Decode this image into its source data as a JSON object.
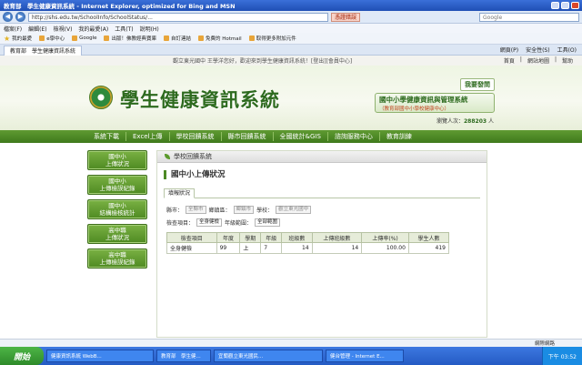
{
  "window": {
    "title": "教育部　學生健康資訊系統 - Internet Explorer, optimized for Bing and MSN"
  },
  "address": {
    "url": "http://shs.edu.tw/SchoolInfo/SchoolStatus/...",
    "cert": "憑證錯誤",
    "search_placeholder": "Google"
  },
  "menu": [
    "檔案(F)",
    "編輯(E)",
    "檢視(V)",
    "我的最愛(A)",
    "工具(T)",
    "說明(H)"
  ],
  "favorites": {
    "label": "我的最愛",
    "items": [
      "e學中心",
      "Google",
      "出版！佛教經典寶庫",
      "自訂連結",
      "免費的 Hotmail",
      "取得更多附加元件"
    ]
  },
  "tab": {
    "title": "教育部　學生健康資訊系統",
    "tools": [
      "網頁(P)",
      "安全性(S)",
      "工具(O)"
    ]
  },
  "page": {
    "welcome": "觀立東光國中 王學洋您好，歡迎來到學生健康資訊系統！[登出][會員中心]",
    "toplinks": [
      "首頁",
      "網站地圖",
      "幫助"
    ],
    "site_title": "學生健康資訊系統",
    "qa_button": "我要發問",
    "platform": {
      "title": "國中小學健康資訊與管理系統",
      "sub": "（教育部國中小學校健康中心）"
    },
    "visitor_label": "瀏覽人次：",
    "visitor_count": "288203",
    "visitor_unit": "人",
    "nav": [
      "系統下載",
      "Excel上傳",
      "學校回饋系統",
      "縣市回饋系統",
      "全國統計&GIS",
      "諮詢服務中心",
      "教育訓練"
    ],
    "side": [
      [
        "國中小",
        "上傳狀況"
      ],
      [
        "國中小",
        "上傳檢誤紀錄"
      ],
      [
        "國中小",
        "結構檢核統計"
      ],
      [
        "高中職",
        "上傳狀況"
      ],
      [
        "高中職",
        "上傳檢誤紀錄"
      ]
    ],
    "panel_title": "學校回饋系統",
    "section_title": "國中小上傳狀況",
    "subtab": "填報狀況",
    "filters": {
      "county_label": "縣市：",
      "county": "全縣市",
      "district_label": "鄉鎮區：",
      "district": "鄉鎮市",
      "school_label": "學校：",
      "school": "觀立東光國中",
      "item_label": "檢查項目：",
      "item": "全身健檢",
      "year_label": "年級範圍：",
      "year": "全部範圍"
    },
    "table": {
      "headers": [
        "檢查項目",
        "年度",
        "學期",
        "年級",
        "班級數",
        "上傳班級數",
        "上傳率(%)",
        "學生人數"
      ],
      "rows": [
        [
          "全身健檢",
          "99",
          "上",
          "7",
          "14",
          "14",
          "100.00",
          "419"
        ]
      ]
    }
  },
  "status": {
    "zone": "網際網路"
  },
  "taskbar": {
    "start": "開始",
    "tasks": [
      "健康資訊系統 WebB...",
      "教育部　學生健...",
      "宜蘭觀立東光國民...",
      "健台管理 - Internet E..."
    ],
    "clock": "下午 03:52"
  },
  "colors": {
    "brand_green": "#3f7a1c",
    "taskbar_blue": "#245bc4"
  }
}
